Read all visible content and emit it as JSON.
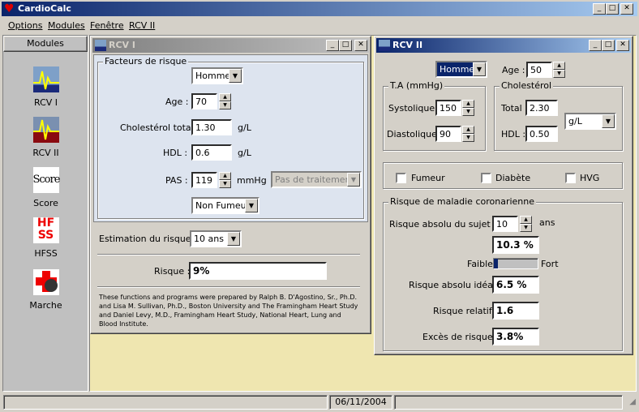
{
  "app": {
    "title": "CardioCalc"
  },
  "menu": [
    "Options",
    "Modules",
    "Fenêtre",
    "RCV II"
  ],
  "sidebar": {
    "header": "Modules",
    "items": [
      {
        "label": "RCV I",
        "icon": "rcv1-icon"
      },
      {
        "label": "RCV II",
        "icon": "rcv2-icon"
      },
      {
        "label": "Score",
        "icon": "score-icon"
      },
      {
        "label": "HFSS",
        "icon": "hfss-icon"
      },
      {
        "label": "Marche",
        "icon": "marche-icon"
      }
    ],
    "hfss_glyph_top": "HF",
    "hfss_glyph_bottom": "SS",
    "score_glyph": "Score"
  },
  "rcv1": {
    "title": "RCV I",
    "group_title": "Facteurs de risque",
    "sex": "Homme",
    "age_label": "Age :",
    "age": "70",
    "chol_label": "Cholestérol total :",
    "chol": "1.30",
    "chol_unit": "g/L",
    "hdl_label": "HDL :",
    "hdl": "0.6",
    "hdl_unit": "g/L",
    "pas_label": "PAS :",
    "pas": "119",
    "pas_unit": "mmHg",
    "treatment": "Pas de traitement",
    "smoker": "Non Fumeur",
    "estimation_label": "Estimation du risque à :",
    "estimation": "10 ans",
    "risk_label": "Risque :",
    "risk": "9%",
    "credits": "These functions and programs were prepared by Ralph B. D'Agostino, Sr., Ph.D. and Lisa M. Sullivan, Ph.D., Boston University and The Framingham Heart Study and Daniel Levy, M.D., Framingham Heart Study, National Heart, Lung and Blood Institute."
  },
  "rcv2": {
    "title": "RCV II",
    "sex": "Homme",
    "age_label": "Age :",
    "age": "50",
    "ta_title": "T.A (mmHg)",
    "sys_label": "Systolique :",
    "sys": "150",
    "dia_label": "Diastolique :",
    "dia": "90",
    "chol_title": "Cholestérol",
    "total_label": "Total :",
    "total": "2.30",
    "hdl_label": "HDL :",
    "hdl": "0.50",
    "unit": "g/L",
    "fumeur": "Fumeur",
    "diabete": "Diabète",
    "hvg": "HVG",
    "risk_title": "Risque de maladie coronarienne",
    "abs_label": "Risque absolu du sujet à :",
    "abs_years": "10",
    "ans": "ans",
    "abs_value": "10.3 %",
    "scale_low": "Faible",
    "scale_high": "Fort",
    "risk_level": 0.103,
    "ideal_label": "Risque absolu idéal :",
    "ideal": "6.5 %",
    "rel_label": "Risque relatif :",
    "rel": "1.6",
    "exces_label": "Excès de risque :",
    "exces": "3.8%"
  },
  "status": {
    "date": "06/11/2004"
  },
  "colors": {
    "titlebar_active": "#0a246a",
    "titlebar_inactive": "#808080",
    "form_bg": "#dde4ef",
    "workspace": "#efe6b0"
  }
}
